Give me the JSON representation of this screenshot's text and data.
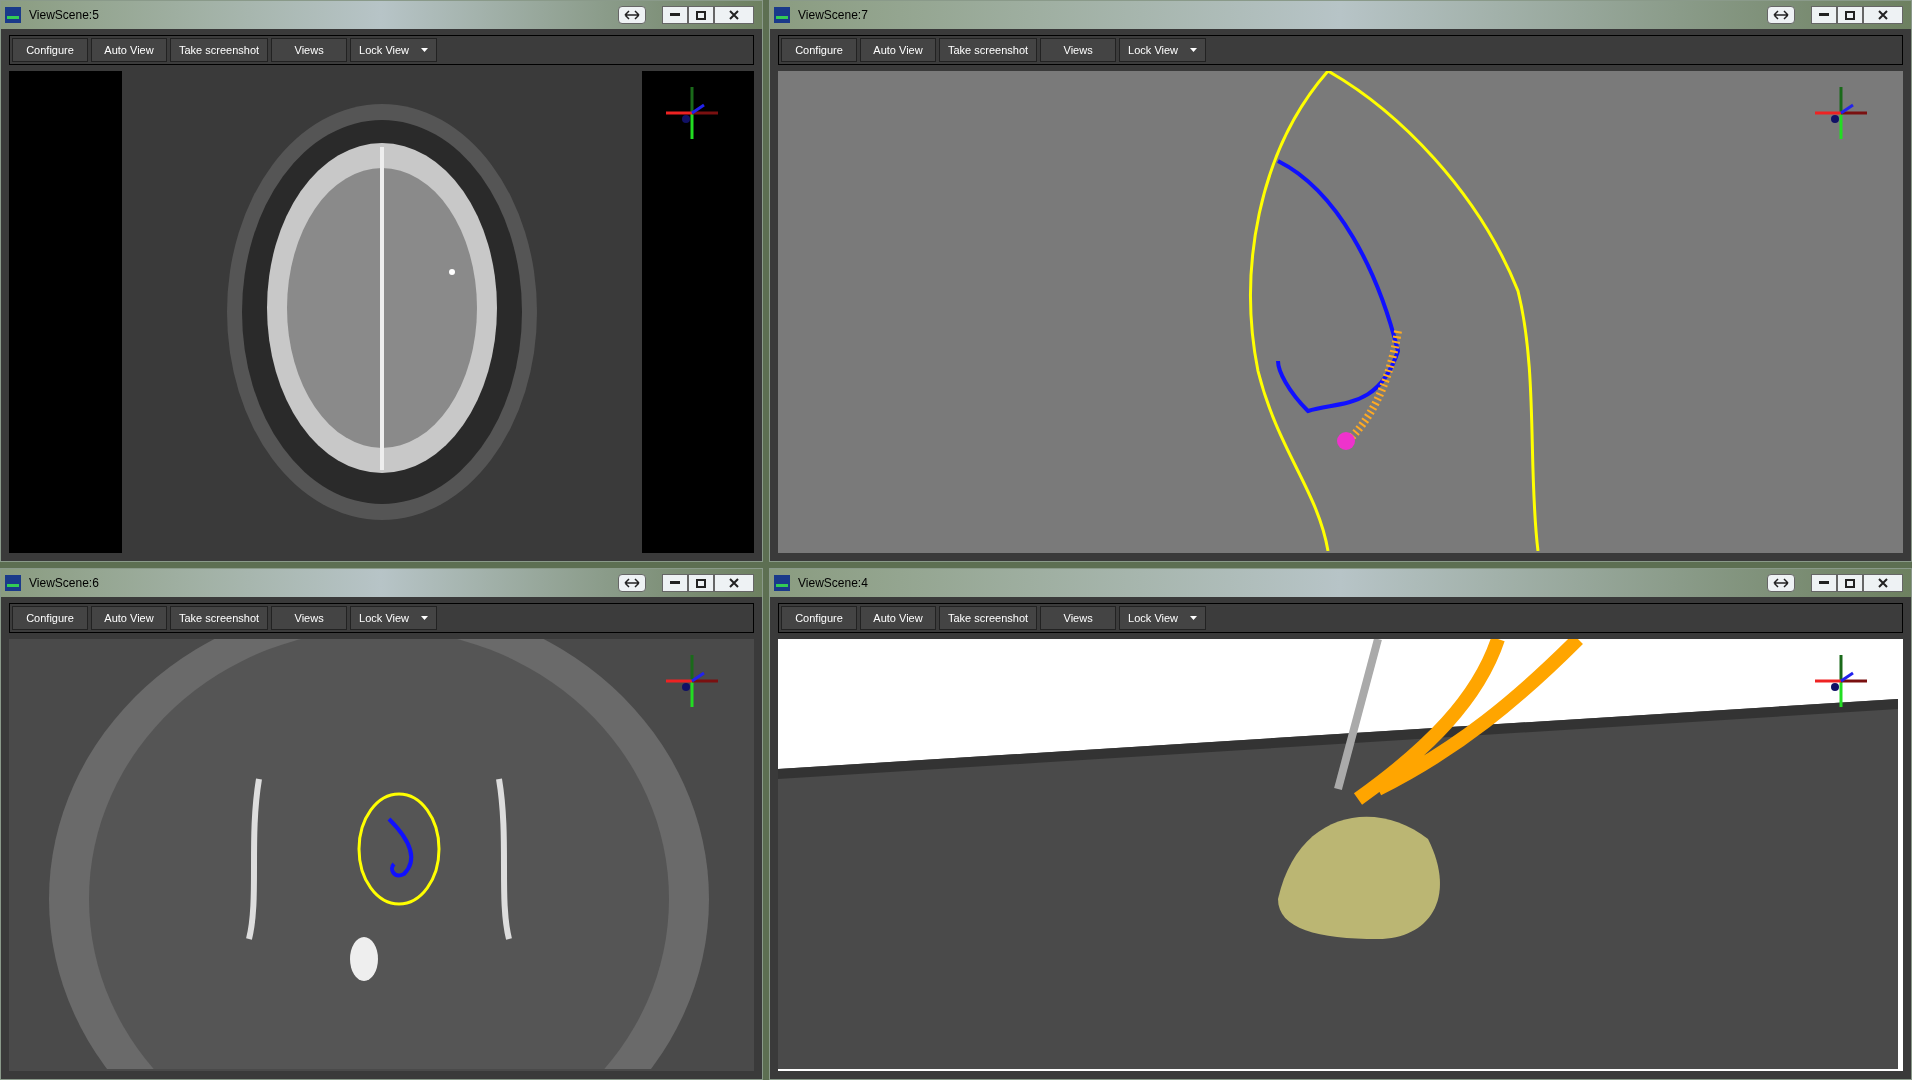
{
  "windows": [
    {
      "title": "ViewScene:5",
      "kind": "slice",
      "toolbar": [
        {
          "label": "Configure",
          "kind": "button"
        },
        {
          "label": "Auto View",
          "kind": "button"
        },
        {
          "label": "Take screenshot",
          "kind": "button"
        },
        {
          "label": "Views",
          "kind": "button"
        },
        {
          "label": "Lock View",
          "kind": "dropdown"
        }
      ]
    },
    {
      "title": "ViewScene:7",
      "kind": "closeup",
      "toolbar": [
        {
          "label": "Configure",
          "kind": "button"
        },
        {
          "label": "Auto View",
          "kind": "button"
        },
        {
          "label": "Take screenshot",
          "kind": "button"
        },
        {
          "label": "Views",
          "kind": "button"
        },
        {
          "label": "Lock View",
          "kind": "dropdown"
        }
      ]
    },
    {
      "title": "ViewScene:6",
      "kind": "overlay",
      "toolbar": [
        {
          "label": "Configure",
          "kind": "button"
        },
        {
          "label": "Auto View",
          "kind": "button"
        },
        {
          "label": "Take screenshot",
          "kind": "button"
        },
        {
          "label": "Views",
          "kind": "button"
        },
        {
          "label": "Lock View",
          "kind": "dropdown"
        }
      ]
    },
    {
      "title": "ViewScene:4",
      "kind": "volume",
      "toolbar": [
        {
          "label": "Configure",
          "kind": "button"
        },
        {
          "label": "Auto View",
          "kind": "button"
        },
        {
          "label": "Take screenshot",
          "kind": "button"
        },
        {
          "label": "Views",
          "kind": "button"
        },
        {
          "label": "Lock View",
          "kind": "dropdown"
        }
      ]
    }
  ]
}
